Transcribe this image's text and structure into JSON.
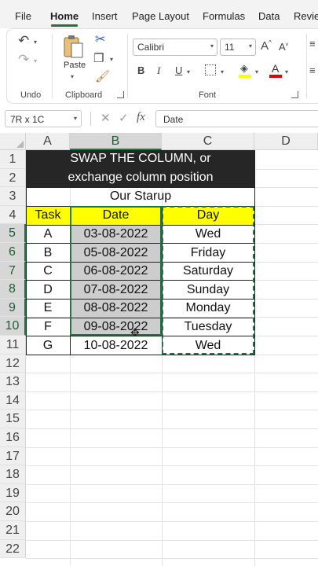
{
  "ribbon": {
    "tabs": [
      "File",
      "Home",
      "Insert",
      "Page Layout",
      "Formulas",
      "Data",
      "Revie"
    ],
    "active_tab": "Home",
    "groups": {
      "undo": "Undo",
      "clipboard": "Clipboard",
      "font": "Font"
    },
    "paste_label": "Paste",
    "font_name": "Calibri",
    "font_size": "11",
    "accent_color": "#217346"
  },
  "formula_bar": {
    "name_box": "7R x 1C",
    "formula": "Date"
  },
  "sheet": {
    "columns": [
      "A",
      "B",
      "C",
      "D"
    ],
    "rows": [
      "1",
      "2",
      "3",
      "4",
      "5",
      "6",
      "7",
      "8",
      "9",
      "10",
      "11",
      "12",
      "13",
      "14",
      "15",
      "16",
      "17",
      "18",
      "19",
      "20",
      "21",
      "22"
    ],
    "title_line1": "SWAP THE COLUMN, or",
    "title_line2": "exchange column position",
    "subtitle": "Our Starup",
    "headers": {
      "task": "Task",
      "date": "Date",
      "day": "Day"
    },
    "data_rows": [
      {
        "task": "A",
        "date": "03-08-2022",
        "day": "Wed"
      },
      {
        "task": "B",
        "date": "05-08-2022",
        "day": "Friday"
      },
      {
        "task": "C",
        "date": "06-08-2022",
        "day": "Saturday"
      },
      {
        "task": "D",
        "date": "07-08-2022",
        "day": "Sunday"
      },
      {
        "task": "E",
        "date": "08-08-2022",
        "day": "Monday"
      },
      {
        "task": "F",
        "date": "09-08-2022",
        "day": "Tuesday"
      },
      {
        "task": "G",
        "date": "10-08-2022",
        "day": "Wed"
      }
    ]
  }
}
